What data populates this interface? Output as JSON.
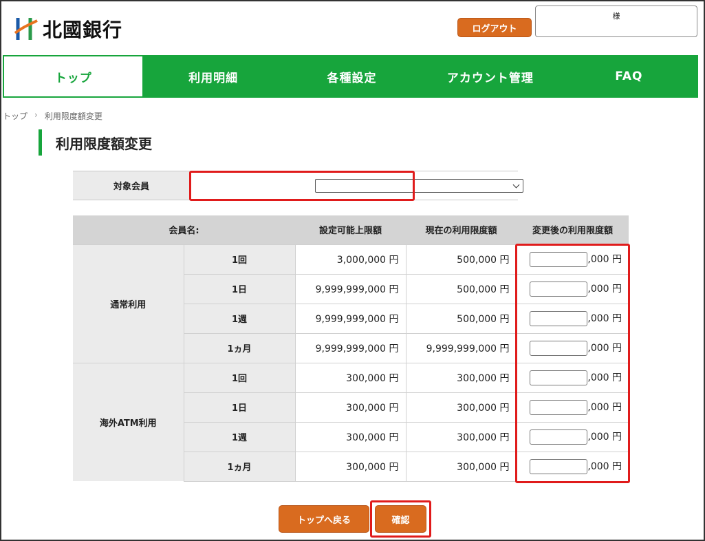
{
  "header": {
    "bank_name": "北國銀行",
    "logout_label": "ログアウト",
    "user_suffix": "様"
  },
  "nav": {
    "items": [
      "トップ",
      "利用明細",
      "各種設定",
      "アカウント管理",
      "FAQ"
    ],
    "active_index": 0
  },
  "breadcrumb": [
    "トップ",
    "利用限度額変更"
  ],
  "page_title": "利用限度額変更",
  "target_member": {
    "label": "対象会員",
    "selected_value": ""
  },
  "limits_table": {
    "headers": [
      "会員名:",
      "設定可能上限額",
      "現在の利用限度額",
      "変更後の利用限度額"
    ],
    "input_suffix": ",000 円",
    "groups": [
      {
        "name": "通常利用",
        "rows": [
          {
            "period": "1回",
            "max": "3,000,000 円",
            "current": "500,000 円"
          },
          {
            "period": "1日",
            "max": "9,999,999,000 円",
            "current": "500,000 円"
          },
          {
            "period": "1週",
            "max": "9,999,999,000 円",
            "current": "500,000 円"
          },
          {
            "period": "1ヵ月",
            "max": "9,999,999,000 円",
            "current": "9,999,999,000 円"
          }
        ]
      },
      {
        "name": "海外ATM利用",
        "rows": [
          {
            "period": "1回",
            "max": "300,000 円",
            "current": "300,000 円"
          },
          {
            "period": "1日",
            "max": "300,000 円",
            "current": "300,000 円"
          },
          {
            "period": "1週",
            "max": "300,000 円",
            "current": "300,000 円"
          },
          {
            "period": "1ヵ月",
            "max": "300,000 円",
            "current": "300,000 円"
          }
        ]
      }
    ]
  },
  "buttons": {
    "back_label": "トップへ戻る",
    "confirm_label": "確認"
  },
  "colors": {
    "nav_green": "#17a53c",
    "button_orange": "#d96b1f",
    "highlight_red": "#e01b1b"
  }
}
